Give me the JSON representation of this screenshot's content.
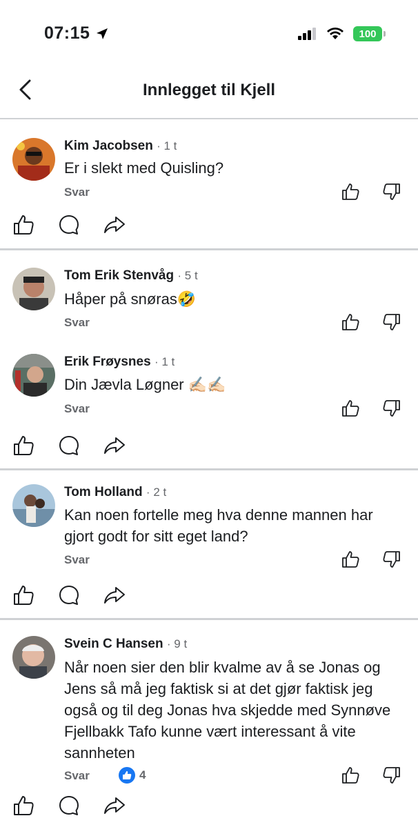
{
  "status_bar": {
    "time": "07:15",
    "battery": "100"
  },
  "nav": {
    "title": "Innlegget til Kjell"
  },
  "threads": [
    {
      "comments": [
        {
          "name": "Kim Jacobsen",
          "time": "1 t",
          "text": "Er i slekt med Quisling?",
          "reply": "Svar"
        }
      ]
    },
    {
      "comments": [
        {
          "name": "Tom Erik Stenvåg",
          "time": "5 t",
          "text": "Håper på snøras🤣",
          "reply": "Svar"
        },
        {
          "name": "Erik Frøysnes",
          "time": "1 t",
          "text": "Din Jævla Løgner ✍🏻✍🏻",
          "reply": "Svar"
        }
      ]
    },
    {
      "comments": [
        {
          "name": "Tom Holland",
          "time": "2 t",
          "text": "Kan noen fortelle meg hva denne mannen har gjort godt for sitt eget land?",
          "reply": "Svar"
        }
      ]
    },
    {
      "comments": [
        {
          "name": "Svein C Hansen",
          "time": "9 t",
          "text": "Når noen sier den blir kvalme av å se Jonas og Jens så må jeg faktisk si at det gjør faktisk jeg også og til deg Jonas hva skjedde med Synnøve Fjellbakk Tafo kunne vært interessant å vite sannheten",
          "reply": "Svar",
          "reactions": "4"
        }
      ]
    }
  ],
  "colors": {
    "accent": "#1877f2",
    "divider": "#cfd1d4",
    "muted": "#65676b",
    "battery": "#34c759"
  },
  "icons": [
    "location-arrow-icon",
    "cellular-signal-icon",
    "wifi-icon",
    "battery-icon",
    "chevron-left-icon",
    "thumbs-up-icon",
    "thumbs-down-icon",
    "comment-bubble-icon",
    "share-arrow-icon"
  ]
}
